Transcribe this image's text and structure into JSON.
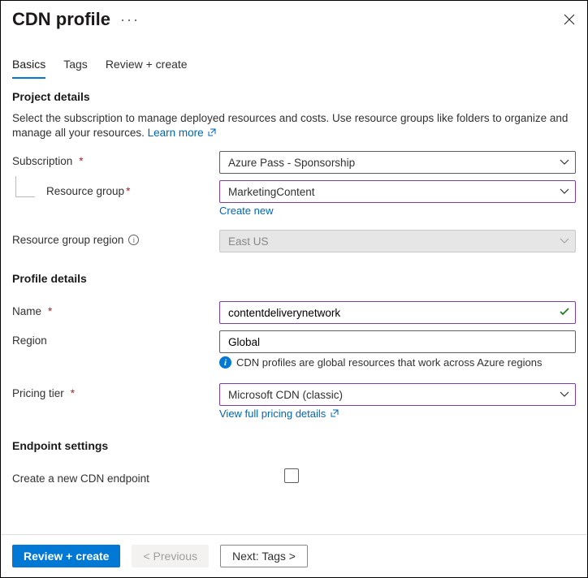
{
  "header": {
    "title": "CDN profile"
  },
  "tabs": {
    "basics": "Basics",
    "tags": "Tags",
    "review": "Review + create"
  },
  "project_details": {
    "heading": "Project details",
    "description": "Select the subscription to manage deployed resources and costs. Use resource groups like folders to organize and manage all your resources.",
    "learn_more": "Learn more"
  },
  "fields": {
    "subscription": {
      "label": "Subscription",
      "value": "Azure Pass - Sponsorship"
    },
    "resource_group": {
      "label": "Resource group",
      "value": "MarketingContent",
      "create_new": "Create new"
    },
    "region": {
      "label": "Resource group region",
      "value": "East US"
    }
  },
  "profile_details": {
    "heading": "Profile details",
    "name": {
      "label": "Name",
      "value": "contentdeliverynetwork"
    },
    "region": {
      "label": "Region",
      "value": "Global",
      "info": "CDN profiles are global resources that work across Azure regions"
    },
    "pricing": {
      "label": "Pricing tier",
      "value": "Microsoft CDN (classic)",
      "link": "View full pricing details"
    }
  },
  "endpoint": {
    "heading": "Endpoint settings",
    "create_label": "Create a new CDN endpoint"
  },
  "footer": {
    "review": "Review + create",
    "previous": "< Previous",
    "next": "Next: Tags >"
  }
}
